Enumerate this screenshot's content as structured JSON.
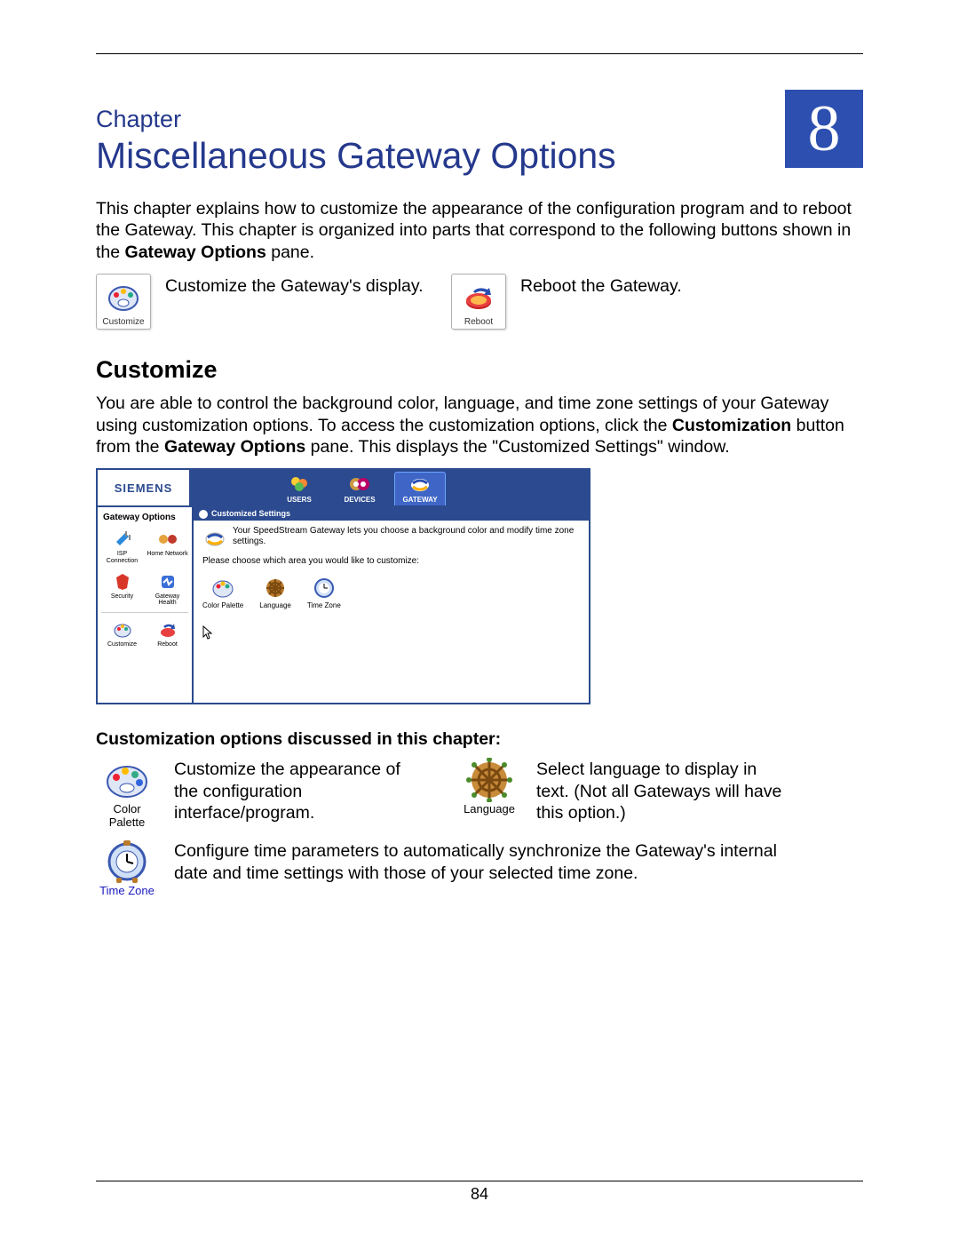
{
  "chapter": {
    "label": "Chapter",
    "number": "8",
    "title": "Miscellaneous Gateway Options"
  },
  "intro": {
    "p1_a": "This chapter explains how to customize the appearance of the configuration program and to reboot the Gateway. This chapter is organized into parts that correspond to the following buttons shown in the ",
    "p1_bold": "Gateway Options",
    "p1_b": " pane."
  },
  "top_icons": {
    "customize": {
      "label": "Customize",
      "desc": "Customize the Gateway's display."
    },
    "reboot": {
      "label": "Reboot",
      "desc": "Reboot the Gateway."
    }
  },
  "section": {
    "title": "Customize"
  },
  "customize_para": {
    "a": "You are able to control the background color, language, and time zone settings of your Gateway using customization options. To access the customization options, click the ",
    "bold1": "Customization",
    "b": " button from the ",
    "bold2": "Gateway Options",
    "c": " pane. This displays the \"Customized Settings\" window."
  },
  "screenshot": {
    "brand": "SIEMENS",
    "tabs": {
      "users": "USERS",
      "devices": "DEVICES",
      "gateway": "GATEWAY"
    },
    "sidebar": {
      "title": "Gateway Options",
      "items": [
        {
          "label": "ISP Connection"
        },
        {
          "label": "Home Network"
        },
        {
          "label": "Security"
        },
        {
          "label": "Gateway Health"
        },
        {
          "label": "Customize"
        },
        {
          "label": "Reboot"
        }
      ]
    },
    "main": {
      "header": "Customized Settings",
      "info": "Your SpeedStream Gateway lets you choose a background color and modify time zone settings.",
      "prompt": "Please choose which area you would like to customize:",
      "options": [
        {
          "label": "Color Palette"
        },
        {
          "label": "Language"
        },
        {
          "label": "Time Zone"
        }
      ]
    }
  },
  "options_heading": "Customization options discussed in this chapter:",
  "options": {
    "color": {
      "caption": "Color Palette",
      "desc": "Customize the appearance of the configuration interface/program."
    },
    "language": {
      "caption": "Language",
      "desc": "Select language to display in text. (Not all Gateways will have this option.)"
    },
    "timezone": {
      "caption": "Time Zone",
      "desc": "Configure time parameters to automatically synchronize the Gateway's internal date and time settings with those of your selected time zone."
    }
  },
  "page_number": "84"
}
